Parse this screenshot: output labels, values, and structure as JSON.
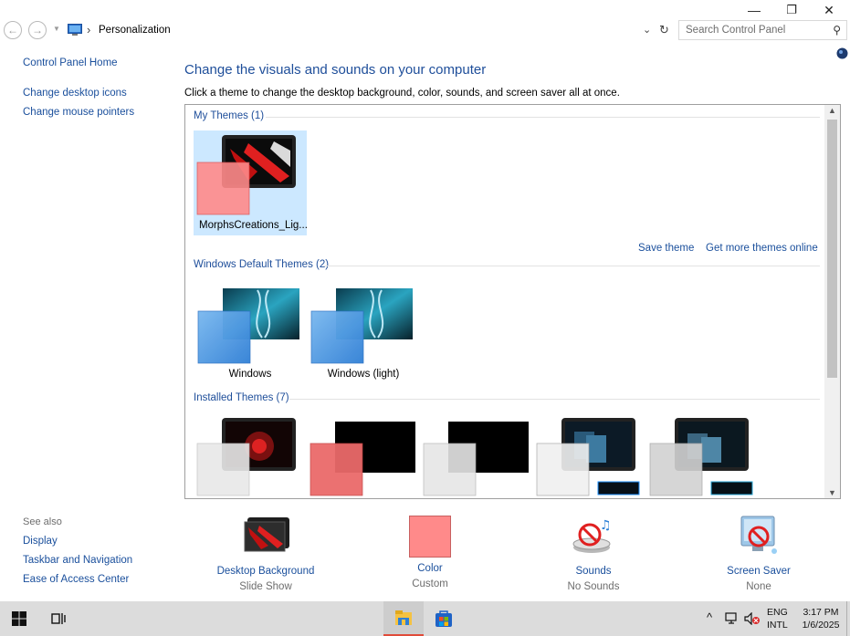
{
  "window": {
    "title_controls": {
      "minimize": "—",
      "restore": "❐",
      "close": "✕"
    }
  },
  "address_bar": {
    "breadcrumb_sep": "›",
    "location": "Personalization",
    "dropdown_icon": "chevron-down-icon",
    "refresh_icon": "refresh-icon",
    "search_placeholder": "Search Control Panel"
  },
  "sidebar": {
    "items": [
      {
        "label": "Control Panel Home"
      },
      {
        "label": "Change desktop icons"
      },
      {
        "label": "Change mouse pointers"
      }
    ],
    "see_also_title": "See also",
    "see_also": [
      {
        "label": "Display"
      },
      {
        "label": "Taskbar and Navigation"
      },
      {
        "label": "Ease of Access Center"
      }
    ]
  },
  "main": {
    "heading": "Change the visuals and sounds on your computer",
    "description": "Click a theme to change the desktop background, color, sounds, and screen saver all at once.",
    "groups": {
      "my_themes": {
        "title": "My Themes (1)",
        "themes": [
          {
            "label": "MorphsCreations_Lig..."
          }
        ],
        "save_link": "Save theme",
        "more_link": "Get more themes online"
      },
      "default_themes": {
        "title": "Windows Default Themes (2)",
        "themes": [
          {
            "label": "Windows"
          },
          {
            "label": "Windows (light)"
          }
        ]
      },
      "installed_themes": {
        "title": "Installed Themes (7)"
      }
    }
  },
  "bottom_bar": {
    "items": [
      {
        "label": "Desktop Background",
        "value": "Slide Show"
      },
      {
        "label": "Color",
        "value": "Custom",
        "color": "#ff8a8a"
      },
      {
        "label": "Sounds",
        "value": "No Sounds"
      },
      {
        "label": "Screen Saver",
        "value": "None"
      }
    ]
  },
  "taskbar": {
    "tray_chevron": "^",
    "language_top": "ENG",
    "language_bottom": "INTL",
    "time": "3:17 PM",
    "date": "1/6/2025"
  },
  "colors": {
    "link": "#1a4f9c",
    "selection": "#cce8ff",
    "accent_blue": "#2f7fd6",
    "accent_red": "#e02020"
  }
}
